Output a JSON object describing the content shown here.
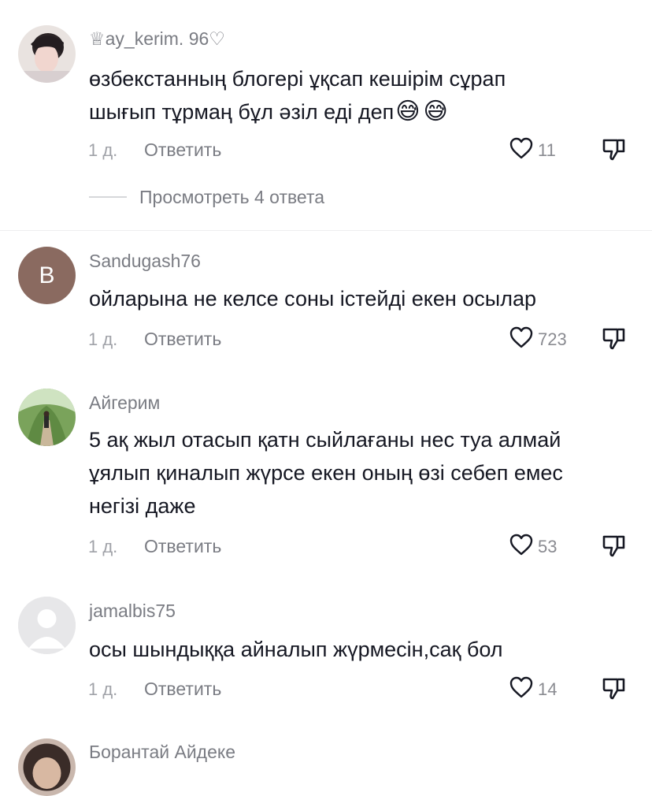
{
  "comments": [
    {
      "username": "♕ay_kerim. 96♡",
      "text": "өзбекстанның блогері ұқсап кешірім сұрап шығып тұрмаң бұл әзіл еді деп",
      "emoji": [
        "😅",
        "😅"
      ],
      "time": "1 д.",
      "reply": "Ответить",
      "likes": "11",
      "view_replies": "Просмотреть 4 ответа"
    },
    {
      "username": "Sandugash76",
      "avatar_letter": "B",
      "avatar_color": "#8a6a60",
      "text": "ойларына не келсе соны істейді екен осылар",
      "time": "1 д.",
      "reply": "Ответить",
      "likes": "723"
    },
    {
      "username": "Айгерим",
      "text_lines": [
        "5 ақ жыл отасып қатн сыйлағаны нес туа алмай",
        "ұялып қиналып жүрсе екен оның өзі себеп емес",
        "негізі даже"
      ],
      "time": "1 д.",
      "reply": "Ответить",
      "likes": "53"
    },
    {
      "username": "jamalbis75",
      "text": "осы шындыққа айналып жүрмесін,сақ бол",
      "time": "1 д.",
      "reply": "Ответить",
      "likes": "14"
    },
    {
      "username": "Борантай Айдеке"
    }
  ],
  "colors": {
    "text": "#161823",
    "secondary": "#7a7c83",
    "icon": "#161823"
  }
}
